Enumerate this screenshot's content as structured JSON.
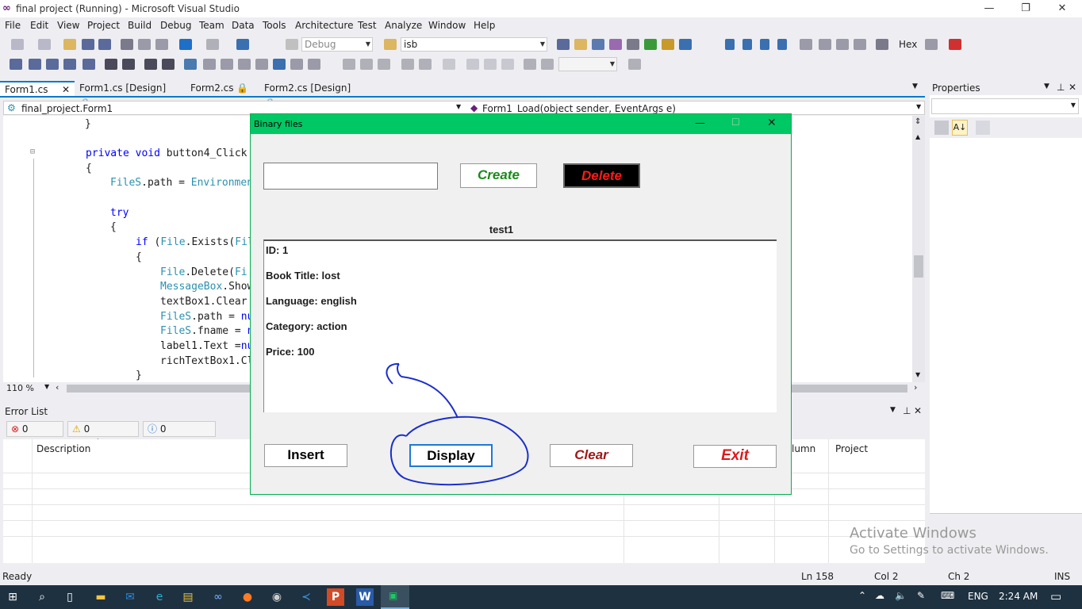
{
  "window": {
    "title": "final project (Running) - Microsoft Visual Studio"
  },
  "menu": [
    "File",
    "Edit",
    "View",
    "Project",
    "Build",
    "Debug",
    "Team",
    "Data",
    "Tools",
    "Architecture",
    "Test",
    "Analyze",
    "Window",
    "Help"
  ],
  "toolbar": {
    "config": "Debug",
    "search": "isb",
    "hex": "Hex"
  },
  "tabs": [
    {
      "label": "Form1.cs"
    },
    {
      "label": "Form1.cs [Design]"
    },
    {
      "label": "Form2.cs"
    },
    {
      "label": "Form2.cs [Design]"
    }
  ],
  "nav": {
    "class": "final_project.Form1",
    "method": "Form1_Load(object sender, EventArgs e)"
  },
  "code": {
    "l1": "}",
    "l2a": "private void ",
    "l2b": "button4_Click",
    "l3": "{",
    "l4a": "FileS",
    "l4b": ".path = ",
    "l4c": "Environmen",
    "l5": "try",
    "l6": "{",
    "l7a": "if",
    "l7b": " (",
    "l7c": "File",
    "l7d": ".Exists(",
    "l7e": "Fil",
    "l8": "{",
    "l9a": "File",
    "l9b": ".Delete(",
    "l9c": "Fi",
    "l10a": "MessageBox",
    "l10b": ".Show",
    "l11": "textBox1.Clear",
    "l12a": "FileS",
    "l12b": ".path = ",
    "l12c": "nu",
    "l13a": "FileS",
    "l13b": ".fname = ",
    "l13c": "n",
    "l14a": "label1.Text =",
    "l14b": "nu",
    "l15": "richTextBox1.Cl",
    "l16": "}"
  },
  "editor": {
    "zoom": "110 %"
  },
  "errorlist": {
    "title": "Error List",
    "errors": "0 Errors",
    "warnings": "0 Warnings",
    "messages": "0 Messages",
    "col_description": "Description",
    "col_column": "lumn",
    "col_project": "Project"
  },
  "properties": {
    "title": "Properties"
  },
  "status": {
    "ready": "Ready",
    "ln": "Ln 158",
    "col": "Col 2",
    "ch": "Ch 2",
    "ins": "INS"
  },
  "watermark": {
    "line1": "Activate Windows",
    "line2": "Go to Settings to activate Windows."
  },
  "taskbar": {
    "lang": "ENG",
    "time": "2:24 AM"
  },
  "form": {
    "title": "Binary files",
    "input_value": "",
    "create": "Create",
    "delete": "Delete",
    "file_label": "test1",
    "record": {
      "id": "ID: 1",
      "title": "Book Title: lost",
      "language": "Language: english",
      "category": "Category: action",
      "price": "Price: 100"
    },
    "insert": "Insert",
    "display": "Display",
    "clear": "Clear",
    "exit": "Exit"
  },
  "colors": {
    "accent": "#007acc",
    "form_header": "#00c864",
    "create_text": "#008000",
    "delete_bg": "#000000",
    "delete_text": "#ff0000",
    "annotation": "#1a2ecc"
  }
}
